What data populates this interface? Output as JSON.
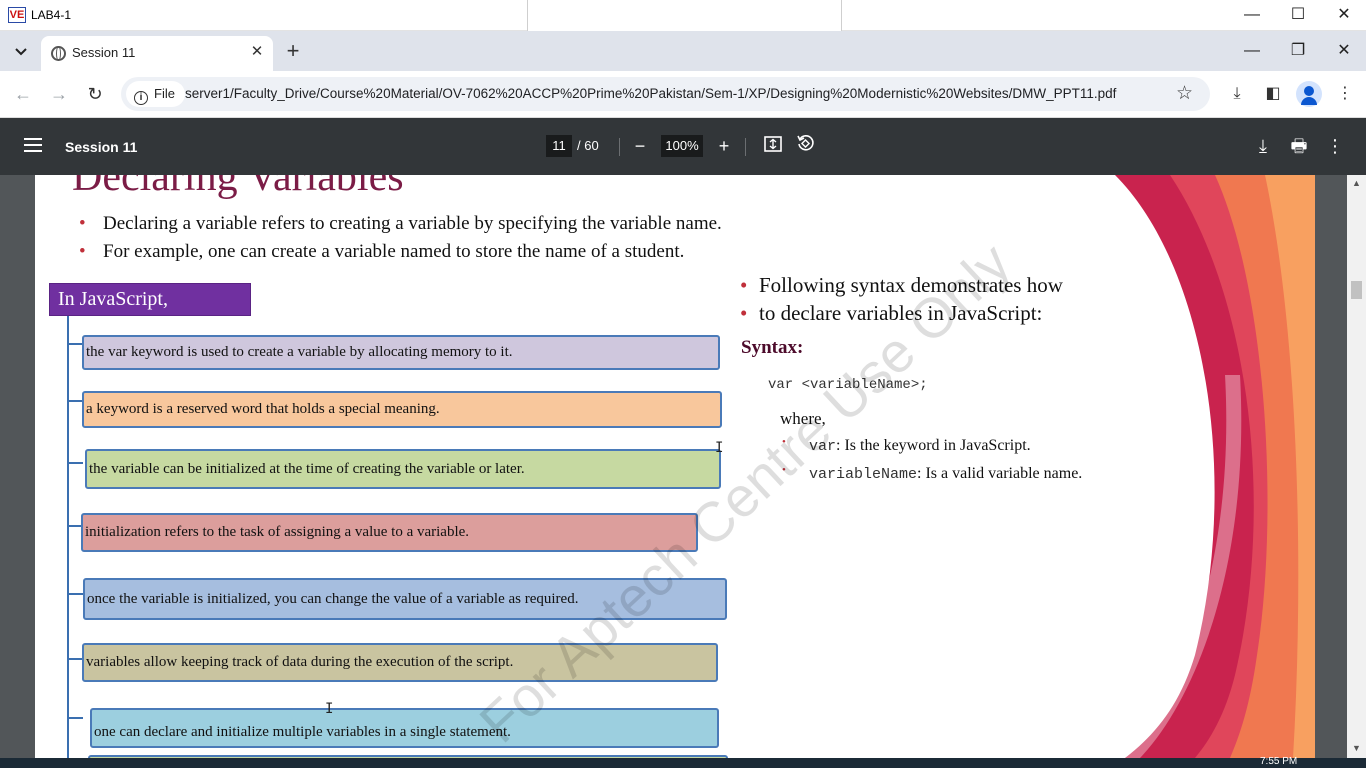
{
  "vm": {
    "title": "LAB4-1",
    "logo": "VE",
    "controls": {
      "minimize": "—",
      "maximize": "☐",
      "close": "✕"
    }
  },
  "browser": {
    "tab_list_icon": "chevron-down-icon",
    "tab": {
      "title": "Session 11",
      "close": "✕"
    },
    "new_tab": "+",
    "controls": {
      "minimize": "—",
      "restore": "❐",
      "close": "✕"
    },
    "nav": {
      "back": "←",
      "forward": "→",
      "reload": "↻"
    },
    "omnibox": {
      "chip_label": "File",
      "url": "server1/Faculty_Drive/Course%20Material/OV-7062%20ACCP%20Prime%20Pakistan/Sem-1/XP/Designing%20Modernistic%20Websites/DMW_PPT11.pdf"
    },
    "toolbar_icons": {
      "bookmark": "☆",
      "download": "⤓",
      "side_panel": "◧",
      "menu": "⋮"
    }
  },
  "pdf_toolbar": {
    "title": "Session 11",
    "page_current": "11",
    "page_total": "/ 60",
    "zoom": "100%",
    "zoom_out": "−",
    "zoom_in": "+",
    "fit_icon": "fit-page-icon",
    "rotate_icon": "rotate-icon",
    "download": "⤓",
    "print": "🖶",
    "more": "⋮"
  },
  "slide": {
    "title": "Declaring Variables",
    "bullets": [
      "Declaring a variable refers to creating a variable by specifying the variable name.",
      "For example, one can create a variable named to store the name of a student."
    ],
    "js_heading": "In JavaScript,",
    "items": [
      {
        "text": "the var keyword is used to create a variable by allocating memory to it.",
        "color": "#cfc7dd"
      },
      {
        "text": "a keyword is a reserved word that holds a special meaning.",
        "color": "#f8c79c"
      },
      {
        "text": "the variable can be initialized at the time of creating the variable or later.",
        "color": "#c6d9a1"
      },
      {
        "text": "initialization refers to the task of assigning a value to a variable.",
        "color": "#dc9e9c"
      },
      {
        "text": "once the variable is initialized, you can change the value of a variable as required.",
        "color": "#a6bedf"
      },
      {
        "text": "variables allow keeping track of data during the execution of the script.",
        "color": "#c9c4a0"
      },
      {
        "text": "one can declare and initialize multiple variables in a single statement.",
        "color": "#9ccfdf"
      }
    ],
    "right_bullet_line1": "Following syntax demonstrates how",
    "right_bullet_line2": "to declare variables in JavaScript:",
    "syntax_label": "Syntax:",
    "syntax_code": "var <variableName>;",
    "where": "where,",
    "sub_bullets": [
      {
        "term": "var",
        "desc": ": Is the keyword in JavaScript."
      },
      {
        "term": "variableName",
        "desc": ": Is a valid variable name."
      }
    ],
    "watermark": "For Aptech Centre Use Only"
  },
  "taskbar": {
    "time": "7:55 PM"
  }
}
